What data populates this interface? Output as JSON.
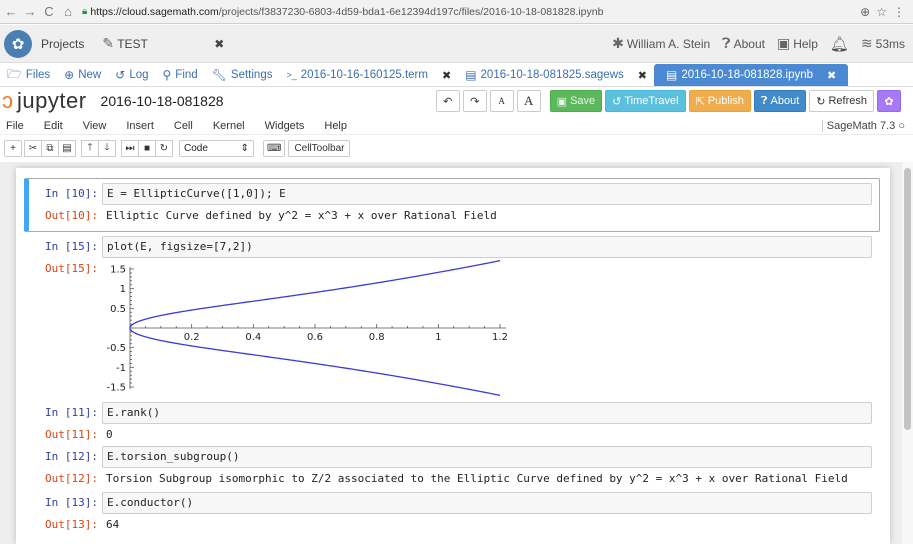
{
  "browser": {
    "url_host": "https://cloud.sagemath.com",
    "url_path": "/projects/f3837230-6803-4d59-bda1-6e12394d197c/files/2016-10-18-081828.ipynb"
  },
  "topbar": {
    "projects_label": "Projects",
    "project_tab": "TEST",
    "user": "William A. Stein",
    "about": "About",
    "help": "Help",
    "ping": "53ms"
  },
  "filetabs": {
    "files": "Files",
    "new": "New",
    "log": "Log",
    "find": "Find",
    "settings": "Settings",
    "tabs": [
      {
        "label": "2016-10-16-160125.term",
        "icon": ">_"
      },
      {
        "label": "2016-10-18-081825.sagews",
        "icon": "▤"
      },
      {
        "label": "2016-10-18-081828.ipynb",
        "icon": "▤"
      }
    ]
  },
  "jupyter": {
    "wordmark": "jupyter",
    "notebook_name": "2016-10-18-081828",
    "save": "Save",
    "timetravel": "TimeTravel",
    "publish": "Publish",
    "about": "About",
    "refresh": "Refresh"
  },
  "menu": {
    "items": [
      "File",
      "Edit",
      "View",
      "Insert",
      "Cell",
      "Kernel",
      "Widgets",
      "Help"
    ],
    "kernel": "SageMath 7.3"
  },
  "toolbar": {
    "cell_type": "Code",
    "celltoolbar": "CellToolbar"
  },
  "cells": [
    {
      "in_prompt": "In [10]:",
      "code": "E = EllipticCurve([1,0]); E",
      "out_prompt": "Out[10]:",
      "output": "Elliptic Curve defined by y^2 = x^3 + x over Rational Field"
    },
    {
      "in_prompt": "In [15]:",
      "code": "plot(E, figsize=[7,2])",
      "out_prompt": "Out[15]:"
    },
    {
      "in_prompt": "In [11]:",
      "code": "E.rank()",
      "out_prompt": "Out[11]:",
      "output": "0"
    },
    {
      "in_prompt": "In [12]:",
      "code": "E.torsion_subgroup()",
      "out_prompt": "Out[12]:",
      "output": "Torsion Subgroup isomorphic to Z/2 associated to the Elliptic Curve defined by y^2 = x^3 + x over Rational Field"
    },
    {
      "in_prompt": "In [13]:",
      "code": "E.conductor()",
      "out_prompt": "Out[13]:",
      "output": "64"
    }
  ],
  "plot": {
    "x_ticks": [
      "0.2",
      "0.4",
      "0.6",
      "0.8",
      "1",
      "1.2"
    ],
    "y_ticks": [
      "1.5",
      "1",
      "0.5",
      "-0.5",
      "-1",
      "-1.5"
    ],
    "curve_color": "#3b3bd6"
  },
  "colors": {
    "accent_blue": "#4b8ad3",
    "save_green": "#5cb85c",
    "publish_orange": "#f0ad4e",
    "jupyter_orange": "#f37726"
  }
}
